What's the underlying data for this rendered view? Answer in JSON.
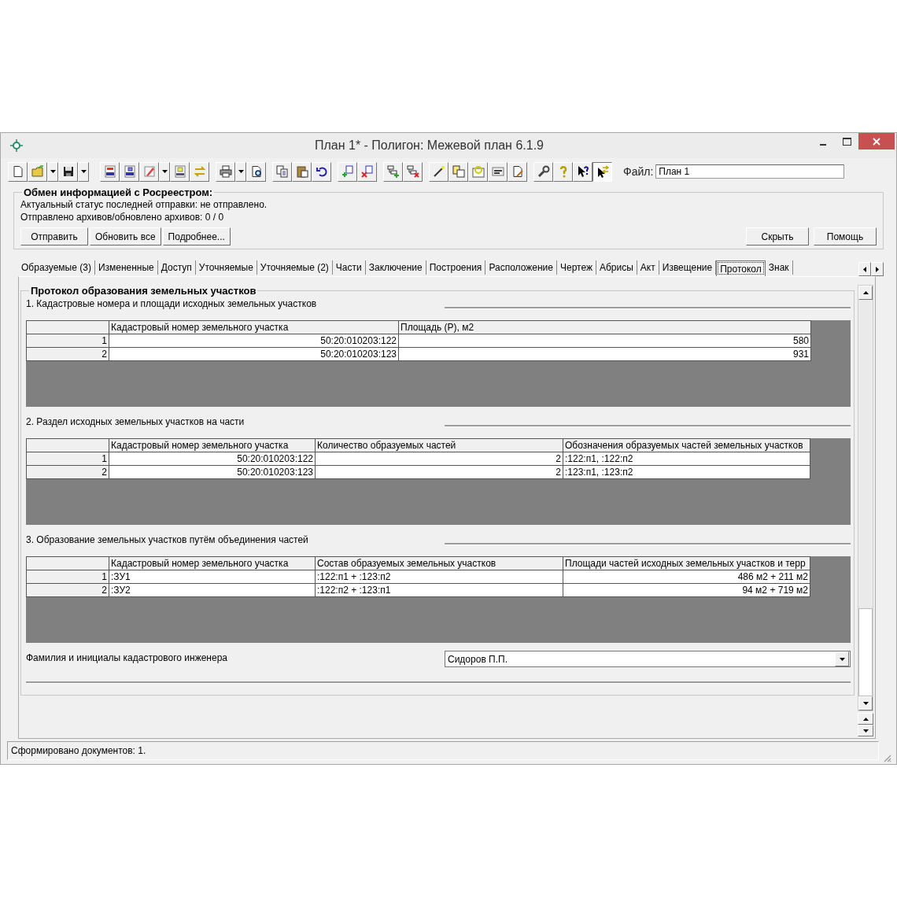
{
  "window": {
    "title": "План 1* - Полигон: Межевой план 6.1.9"
  },
  "toolbar": [
    [
      {
        "kind": "button",
        "pressed": false
      },
      {
        "kind": "split",
        "pressed": false
      },
      {
        "kind": "split",
        "pressed": false
      }
    ],
    [
      {
        "kind": "button",
        "pressed": false
      },
      {
        "kind": "button",
        "pressed": false
      },
      {
        "kind": "split",
        "pressed": false
      },
      {
        "kind": "button",
        "pressed": false
      },
      {
        "kind": "button",
        "pressed": false
      }
    ],
    [
      {
        "kind": "split",
        "pressed": false
      },
      {
        "kind": "button",
        "pressed": false
      }
    ],
    [
      {
        "kind": "button",
        "pressed": false
      },
      {
        "kind": "button",
        "pressed": false
      },
      {
        "kind": "button",
        "pressed": false
      }
    ],
    [
      {
        "kind": "button",
        "pressed": false
      },
      {
        "kind": "button",
        "pressed": false
      }
    ],
    [
      {
        "kind": "button",
        "pressed": false
      },
      {
        "kind": "button",
        "pressed": false
      }
    ],
    [
      {
        "kind": "button",
        "pressed": false
      },
      {
        "kind": "button",
        "pressed": false
      },
      {
        "kind": "button",
        "pressed": false
      },
      {
        "kind": "button",
        "pressed": false
      },
      {
        "kind": "button",
        "pressed": false
      }
    ],
    [
      {
        "kind": "button",
        "pressed": false
      },
      {
        "kind": "button",
        "pressed": false
      },
      {
        "kind": "button",
        "pressed": false
      },
      {
        "kind": "button",
        "pressed": true
      }
    ]
  ],
  "file_field": {
    "label": "Файл:",
    "value": "План 1"
  },
  "exchange": {
    "title": "Обмен информацией с Росреестром:",
    "status": "Актуальный статус последней отправки: не отправлено.",
    "counts": "Отправлено архивов/обновлено архивов: 0 / 0",
    "left_buttons": [
      "Отправить",
      "Обновить все",
      "Подробнее..."
    ],
    "right_buttons": [
      "Скрыть",
      "Помощь"
    ]
  },
  "tabs": [
    {
      "label": "Образуемые (3)",
      "selected": false
    },
    {
      "label": "Измененные",
      "selected": false
    },
    {
      "label": "Доступ",
      "selected": false
    },
    {
      "label": "Уточняемые",
      "selected": false
    },
    {
      "label": "Уточняемые (2)",
      "selected": false
    },
    {
      "label": "Части",
      "selected": false
    },
    {
      "label": "Заключение",
      "selected": false
    },
    {
      "label": "Построения",
      "selected": false
    },
    {
      "label": "Расположение",
      "selected": false
    },
    {
      "label": "Чертеж",
      "selected": false
    },
    {
      "label": "Абрисы",
      "selected": false
    },
    {
      "label": "Акт",
      "selected": false
    },
    {
      "label": "Извещение",
      "selected": false
    },
    {
      "label": "Протокол",
      "selected": true
    },
    {
      "label": "Знак",
      "selected": false
    }
  ],
  "protocol": {
    "title": "Протокол образования земельных участков",
    "sections": [
      {
        "title": "1. Кадастровые номера и площади исходных земельных участков",
        "columns": [
          {
            "label": "Кадастровый номер земельного участка",
            "kind": "number"
          },
          {
            "label": "Площадь (Р), м2",
            "kind": "number"
          }
        ],
        "rows": [
          {
            "number": "1",
            "cells": [
              "50:20:010203:122",
              "580"
            ]
          },
          {
            "number": "2",
            "cells": [
              "50:20:010203:123",
              "931"
            ]
          }
        ]
      },
      {
        "title": "2. Раздел исходных земельных участков на части",
        "columns": [
          {
            "label": "Кадастровый номер земельного участка",
            "kind": "number"
          },
          {
            "label": "Количество образуемых частей",
            "kind": "number"
          },
          {
            "label": "Обозначения образуемых частей земельных участков",
            "kind": "text"
          }
        ],
        "rows": [
          {
            "number": "1",
            "cells": [
              "50:20:010203:122",
              "2",
              ":122:п1, :122:п2"
            ]
          },
          {
            "number": "2",
            "cells": [
              "50:20:010203:123",
              "2",
              ":123:п1, :123:п2"
            ]
          }
        ]
      },
      {
        "title": "3. Образование земельных участков путём объединения частей",
        "columns": [
          {
            "label": "Кадастровый номер земельного участка",
            "kind": "text"
          },
          {
            "label": "Состав образуемых земельных участков",
            "kind": "text"
          },
          {
            "label": "Площади частей исходных земельных участков и терр",
            "kind": "number"
          }
        ],
        "rows": [
          {
            "number": "1",
            "cells": [
              ":ЗУ1",
              ":122:п1 + :123:п2",
              "486 м2 + 211 м2"
            ]
          },
          {
            "number": "2",
            "cells": [
              ":ЗУ2",
              ":122:п2 + :123:п1",
              "94 м2 + 719 м2"
            ]
          }
        ]
      }
    ],
    "engineer": {
      "label": "Фамилия и инициалы кадастрового инженера",
      "value": "Сидоров П.П."
    }
  },
  "status_bar": "Сформировано документов: 1."
}
